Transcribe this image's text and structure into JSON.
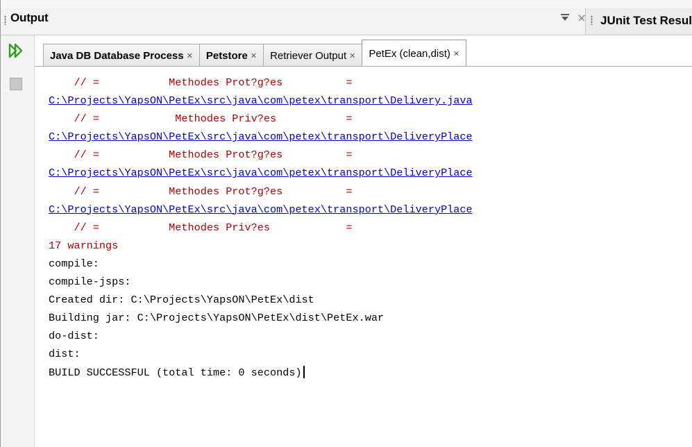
{
  "window": {
    "title": "Output",
    "junit_tab_label": "JUnit Test Results"
  },
  "icons": {
    "dropdown": "dropdown-icon",
    "close": "close-icon",
    "rerun": "rerun-icon",
    "stop": "stop-icon"
  },
  "colors": {
    "warning_text": "#b30000",
    "link_text": "#0000cc",
    "rerun_icon": "#2ea01e"
  },
  "tabs": [
    {
      "label": "Java DB Database Process",
      "bold": true
    },
    {
      "label": "Petstore",
      "bold": true
    },
    {
      "label": "Retriever Output",
      "bold": false
    },
    {
      "label": "PetEx (clean,dist)",
      "bold": false,
      "active": true
    }
  ],
  "output_lines": [
    {
      "type": "warn",
      "text": "    // =           Methodes Prot?g?es          ="
    },
    {
      "type": "link",
      "text": "C:\\Projects\\YapsON\\PetEx\\src\\java\\com\\petex\\transport\\Delivery.java"
    },
    {
      "type": "warn",
      "text": "    // =            Methodes Priv?es           ="
    },
    {
      "type": "link",
      "text": "C:\\Projects\\YapsON\\PetEx\\src\\java\\com\\petex\\transport\\DeliveryPlace"
    },
    {
      "type": "warn",
      "text": "    // =           Methodes Prot?g?es          ="
    },
    {
      "type": "link",
      "text": "C:\\Projects\\YapsON\\PetEx\\src\\java\\com\\petex\\transport\\DeliveryPlace"
    },
    {
      "type": "warn",
      "text": "    // =           Methodes Prot?g?es          ="
    },
    {
      "type": "link",
      "text": "C:\\Projects\\YapsON\\PetEx\\src\\java\\com\\petex\\transport\\DeliveryPlace"
    },
    {
      "type": "warn",
      "text": "    // =           Methodes Priv?es            ="
    },
    {
      "type": "warn",
      "text": "17 warnings"
    },
    {
      "type": "norm",
      "text": "compile:"
    },
    {
      "type": "norm",
      "text": "compile-jsps:"
    },
    {
      "type": "norm",
      "text": "Created dir: C:\\Projects\\YapsON\\PetEx\\dist"
    },
    {
      "type": "norm",
      "text": "Building jar: C:\\Projects\\YapsON\\PetEx\\dist\\PetEx.war"
    },
    {
      "type": "norm",
      "text": "do-dist:"
    },
    {
      "type": "norm",
      "text": "dist:"
    },
    {
      "type": "norm",
      "text": "BUILD SUCCESSFUL (total time: 0 seconds)",
      "cursor": true
    }
  ]
}
